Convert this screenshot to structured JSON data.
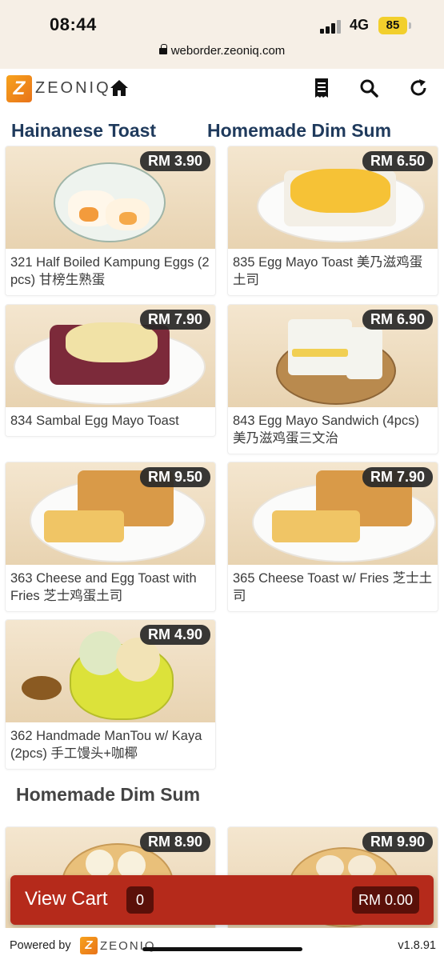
{
  "status_bar": {
    "time": "08:44",
    "network": "4G",
    "battery": "85",
    "url": "weborder.zeoniq.com"
  },
  "header": {
    "logo_text": "ZEONIQ",
    "icons": [
      "home-icon",
      "receipt-icon",
      "search-icon",
      "refresh-icon"
    ]
  },
  "tabs": [
    {
      "label": "Hainanese Toast",
      "active": true
    },
    {
      "label": "Homemade Dim Sum",
      "active": false
    }
  ],
  "products": [
    {
      "price": "RM 3.90",
      "title": "321 Half Boiled Kampung Eggs (2 pcs) 甘榜生熟蛋"
    },
    {
      "price": "RM 6.50",
      "title": "835 Egg Mayo Toast 美乃滋鸡蛋土司"
    },
    {
      "price": "RM 7.90",
      "title": "834 Sambal Egg Mayo Toast"
    },
    {
      "price": "RM 6.90",
      "title": "843 Egg Mayo Sandwich (4pcs) 美乃滋鸡蛋三文治"
    },
    {
      "price": "RM 9.50",
      "title": "363 Cheese and Egg Toast with Fries 芝士鸡蛋土司"
    },
    {
      "price": "RM 7.90",
      "title": "365 Cheese Toast w/ Fries 芝士土司"
    },
    {
      "price": "RM 4.90",
      "title": "362 Handmade ManTou w/ Kaya (2pcs) 手工馒头+咖椰"
    },
    {
      "price": "RM 8.90",
      "title": ""
    },
    {
      "price": "RM 9.90",
      "title": ""
    }
  ],
  "section_heading": "Homemade Dim Sum",
  "cart": {
    "label": "View Cart",
    "count": "0",
    "total": "RM 0.00"
  },
  "footer": {
    "powered_by": "Powered by",
    "logo_text": "ZEONIQ",
    "version": "v1.8.91"
  },
  "colors": {
    "brand_orange": "#f39a1e",
    "tab_text": "#1f3a5c",
    "cart_bar": "#b52a1b",
    "cart_badge": "#5a1009",
    "price_badge": "#282828"
  }
}
